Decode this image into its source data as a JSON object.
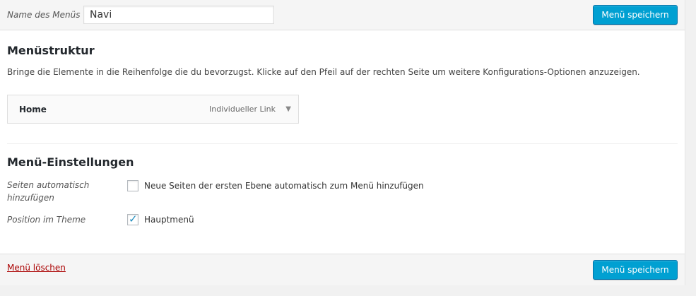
{
  "header": {
    "menu_name_label": "Name des Menüs",
    "menu_name_value": "Navi",
    "save_label": "Menü speichern"
  },
  "structure": {
    "title": "Menüstruktur",
    "description": "Bringe die Elemente in die Reihenfolge die du bevorzugst. Klicke auf den Pfeil auf der rechten Seite um weitere Konfigurations-Optionen anzuzeigen.",
    "items": [
      {
        "title": "Home",
        "type": "Individueller Link",
        "arrow_icon": "triangle-down-icon"
      }
    ]
  },
  "settings": {
    "title": "Menü-Einstellungen",
    "auto_add": {
      "label": "Seiten automatisch hinzufügen",
      "option": "Neue Seiten der ersten Ebene automatisch zum Menü hinzufügen",
      "checked": false
    },
    "position": {
      "label": "Position im Theme",
      "option": "Hauptmenü",
      "checked": true,
      "check_glyph": "✓"
    }
  },
  "footer": {
    "delete_label": "Menü löschen",
    "save_label": "Menü speichern"
  },
  "colors": {
    "primary": "#00a0d2",
    "delete": "#a00000",
    "check": "#1e8cbe"
  }
}
